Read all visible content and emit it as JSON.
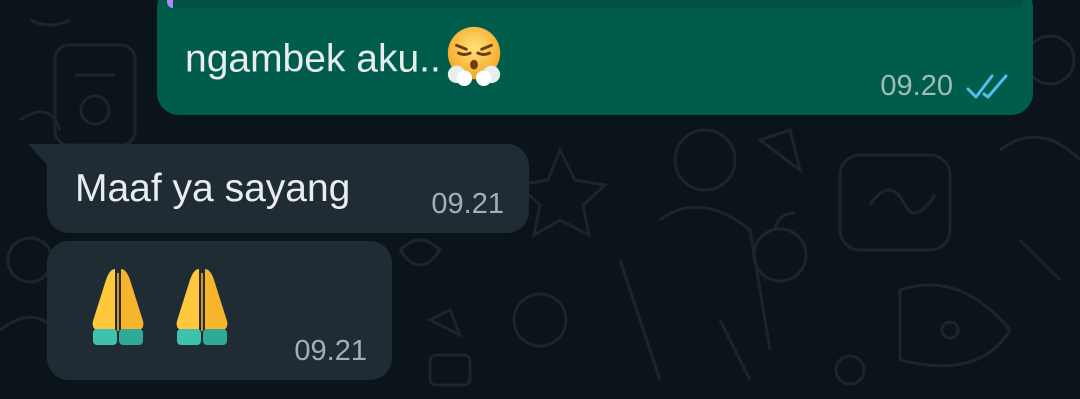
{
  "messages": [
    {
      "direction": "outgoing",
      "text": "ngambek aku..",
      "emoji": "face-with-steam-from-nose",
      "time": "09.20",
      "status": "read",
      "status_icon": "double-check-icon"
    },
    {
      "direction": "incoming",
      "text": "Maaf ya sayang",
      "time": "09.21"
    },
    {
      "direction": "incoming",
      "emoji": [
        "folded-hands",
        "folded-hands"
      ],
      "time": "09.21"
    }
  ],
  "colors": {
    "background": "#0b141a",
    "outgoing_bubble": "#005c4b",
    "incoming_bubble": "#202c33",
    "text": "#e9edef",
    "timestamp": "#9fb0b9",
    "read_ticks": "#53bdeb"
  }
}
